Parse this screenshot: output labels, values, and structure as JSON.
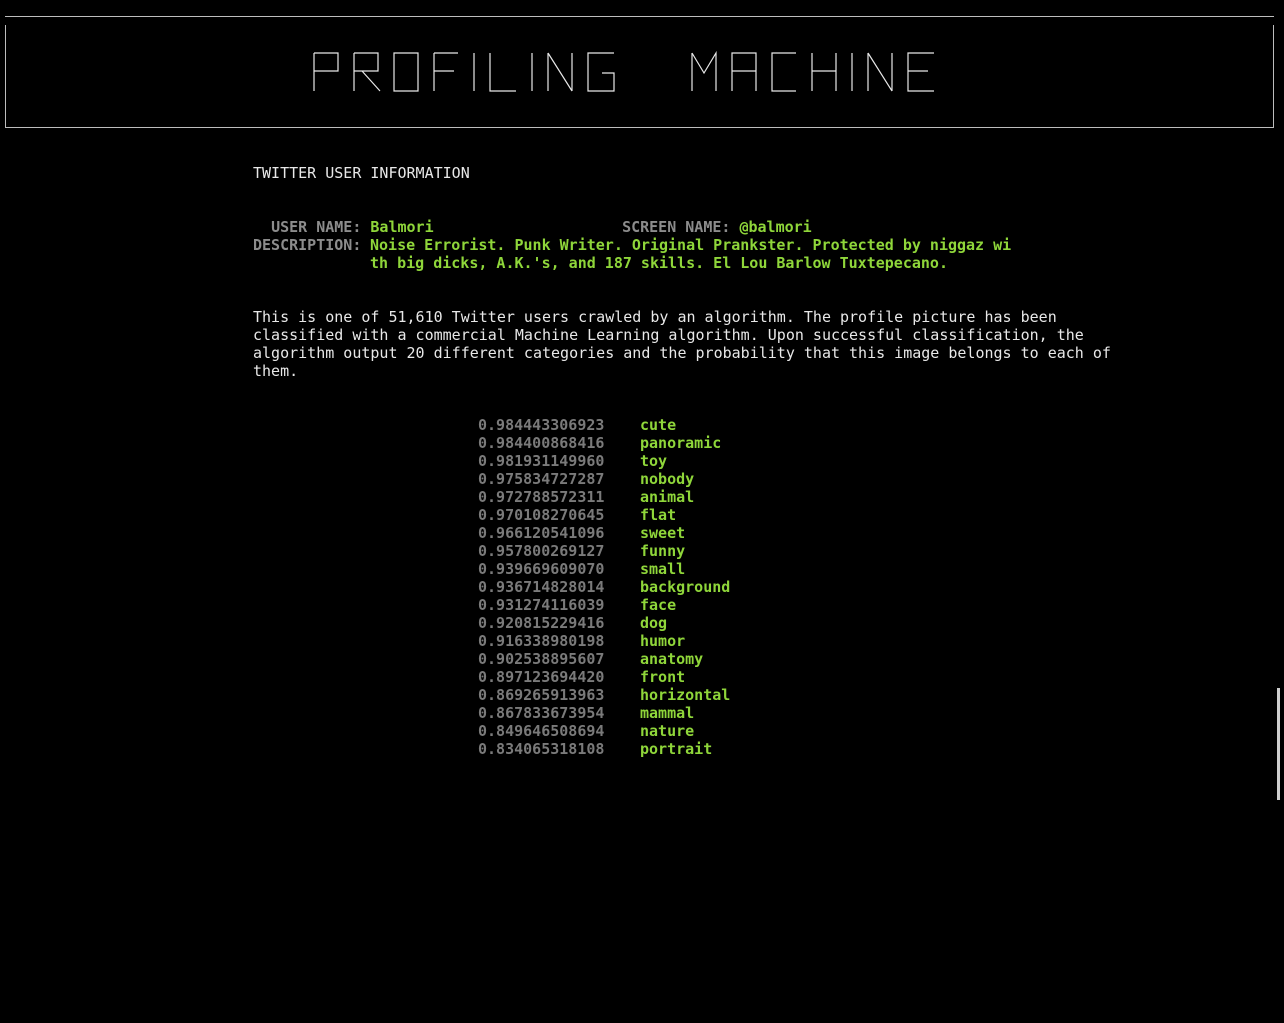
{
  "banner": {
    "title": "PROFILING MACHINE"
  },
  "section_title": "TWITTER USER INFORMATION",
  "user": {
    "user_name_label": "USER NAME:",
    "user_name": "Balmori",
    "screen_name_label": "SCREEN NAME:",
    "screen_name": "@balmori",
    "description_label": "DESCRIPTION:",
    "description": "Noise Errorist. Punk Writer. Original Prankster. Protected by niggaz with big dicks, A.K.'s, and 187 skills. El Lou Barlow Tuxtepecano."
  },
  "intro_text": "This is one of 51,610 Twitter users crawled by an algorithm. The profile picture has been classified with a commercial Machine Learning algorithm. Upon successful classification, the algorithm output 20 different categories and the probability that this image belongs to each of them.",
  "categories": [
    {
      "score": "0.984443306923",
      "name": "cute"
    },
    {
      "score": "0.984400868416",
      "name": "panoramic"
    },
    {
      "score": "0.981931149960",
      "name": "toy"
    },
    {
      "score": "0.975834727287",
      "name": "nobody"
    },
    {
      "score": "0.972788572311",
      "name": "animal"
    },
    {
      "score": "0.970108270645",
      "name": "flat"
    },
    {
      "score": "0.966120541096",
      "name": "sweet"
    },
    {
      "score": "0.957800269127",
      "name": "funny"
    },
    {
      "score": "0.939669609070",
      "name": "small"
    },
    {
      "score": "0.936714828014",
      "name": "background"
    },
    {
      "score": "0.931274116039",
      "name": "face"
    },
    {
      "score": "0.920815229416",
      "name": "dog"
    },
    {
      "score": "0.916338980198",
      "name": "humor"
    },
    {
      "score": "0.902538895607",
      "name": "anatomy"
    },
    {
      "score": "0.897123694420",
      "name": "front"
    },
    {
      "score": "0.869265913963",
      "name": "horizontal"
    },
    {
      "score": "0.867833673954",
      "name": "mammal"
    },
    {
      "score": "0.849646508694",
      "name": "nature"
    },
    {
      "score": "0.834065318108",
      "name": "portrait"
    }
  ],
  "colors": {
    "background": "#000000",
    "accent": "#8fd63a",
    "label": "#8c8c8c",
    "text": "#e8e8e8"
  }
}
